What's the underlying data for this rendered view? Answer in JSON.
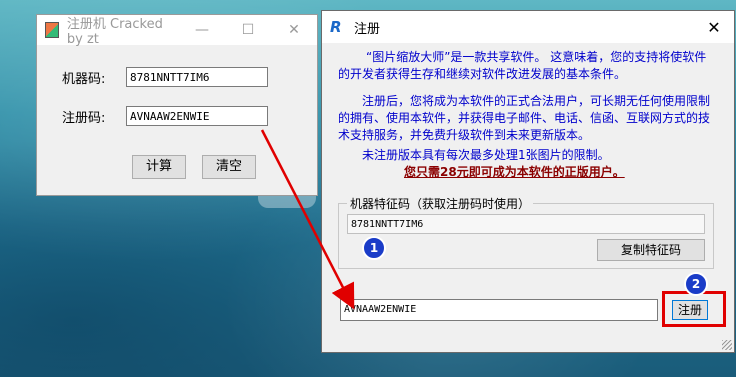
{
  "keygen": {
    "title": "注册机 Cracked by zt",
    "machine_code_label": "机器码:",
    "machine_code_value": "8781NNTT7IM6",
    "reg_code_label": "注册码:",
    "reg_code_value": "AVNAAW2ENWIE",
    "calc_button": "计算",
    "clear_button": "清空",
    "controls": {
      "minimize": "—",
      "maximize": "☐",
      "close": "✕"
    }
  },
  "register": {
    "title": "注册",
    "logo": "R",
    "close": "✕",
    "para1": "“图片缩放大师”是一款共享软件。 这意味着，您的支持将使软件的开发者获得生存和继续对软件改进发展的基本条件。",
    "para2": "注册后，您将成为本软件的正式合法用户，可长期无任何使用限制的拥有、使用本软件，并获得电子邮件、电话、信函、互联网方式的技术支持服务，并免费升级软件到未来更新版本。",
    "para3": "未注册版本具有每次最多处理1张图片的限制。",
    "price_note": "您只需28元即可成为本软件的正版用户。",
    "group_label": "机器特征码（获取注册码时使用）",
    "machine_feature_code": "8781NNTT7IM6",
    "copy_button": "复制特征码",
    "code_input_value": "AVNAAW2ENWIE",
    "register_button": "注册"
  },
  "annotations": {
    "step1": "1",
    "step2": "2"
  },
  "colors": {
    "blue_text": "#0000cc",
    "red_text": "#8b0000",
    "highlight": "#e00000",
    "badge": "#1a3cc8"
  }
}
